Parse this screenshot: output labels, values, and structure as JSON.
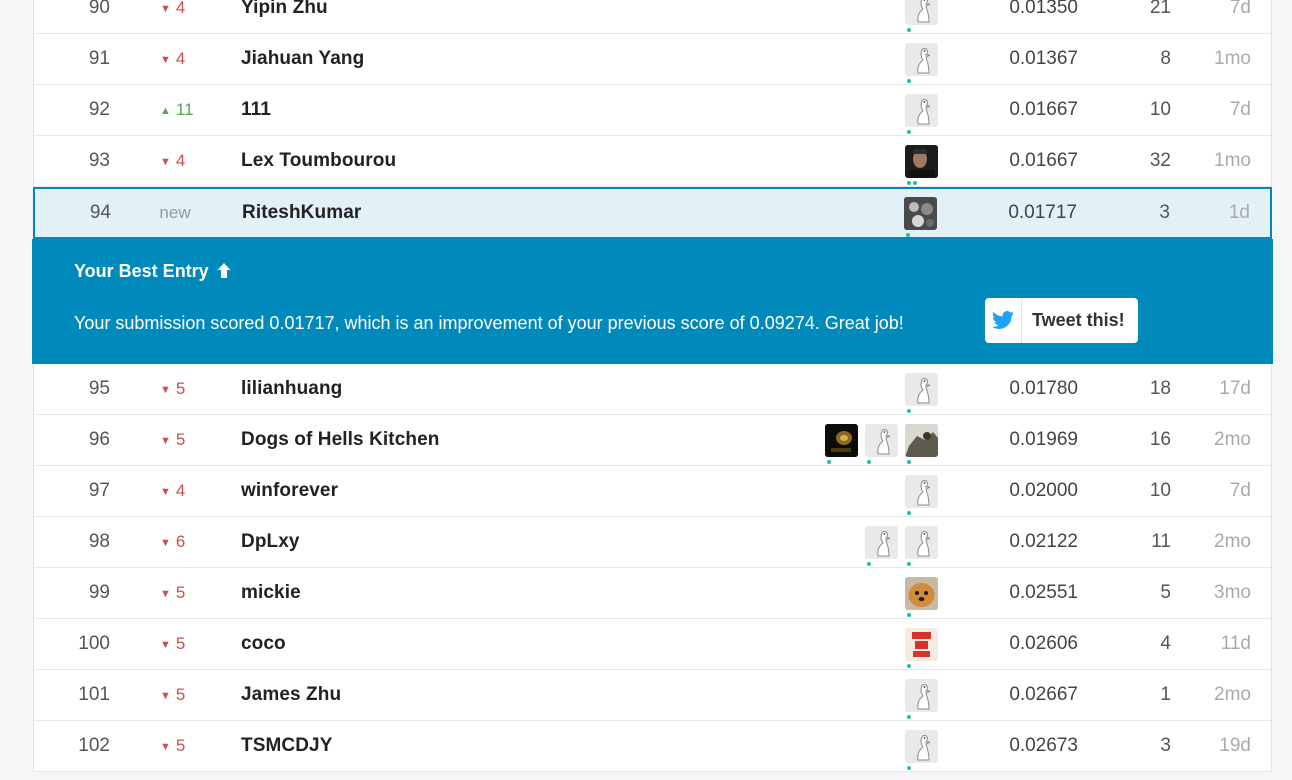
{
  "leaderboard": {
    "rows_above": [
      {
        "rank": "90",
        "change": "4",
        "dir": "down",
        "team": "Yipin Zhu",
        "avatars": [
          "goose"
        ],
        "score": "0.01350",
        "entries": "21",
        "last": "7d"
      },
      {
        "rank": "91",
        "change": "4",
        "dir": "down",
        "team": "Jiahuan Yang",
        "avatars": [
          "goose"
        ],
        "score": "0.01367",
        "entries": "8",
        "last": "1mo"
      },
      {
        "rank": "92",
        "change": "11",
        "dir": "up",
        "team": "111",
        "avatars": [
          "goose"
        ],
        "score": "0.01667",
        "entries": "10",
        "last": "7d"
      },
      {
        "rank": "93",
        "change": "4",
        "dir": "down",
        "team": "Lex Toumbourou",
        "avatars": [
          "dark"
        ],
        "score": "0.01667",
        "entries": "32",
        "last": "1mo"
      }
    ],
    "user_row": {
      "rank": "94",
      "change": "new",
      "dir": "new",
      "team": "RiteshKumar",
      "avatars": [
        "mono"
      ],
      "score": "0.01717",
      "entries": "3",
      "last": "1d"
    },
    "rows_below": [
      {
        "rank": "95",
        "change": "5",
        "dir": "down",
        "team": "lilianhuang",
        "avatars": [
          "goose"
        ],
        "score": "0.01780",
        "entries": "18",
        "last": "17d"
      },
      {
        "rank": "96",
        "change": "5",
        "dir": "down",
        "team": "Dogs of Hells Kitchen",
        "avatars": [
          "gold",
          "goose",
          "mixed"
        ],
        "score": "0.01969",
        "entries": "16",
        "last": "2mo"
      },
      {
        "rank": "97",
        "change": "4",
        "dir": "down",
        "team": "winforever",
        "avatars": [
          "goose"
        ],
        "score": "0.02000",
        "entries": "10",
        "last": "7d"
      },
      {
        "rank": "98",
        "change": "6",
        "dir": "down",
        "team": "DpLxy",
        "avatars": [
          "goose",
          "goose"
        ],
        "score": "0.02122",
        "entries": "11",
        "last": "2mo"
      },
      {
        "rank": "99",
        "change": "5",
        "dir": "down",
        "team": "mickie",
        "avatars": [
          "dog"
        ],
        "score": "0.02551",
        "entries": "5",
        "last": "3mo"
      },
      {
        "rank": "100",
        "change": "5",
        "dir": "down",
        "team": "coco",
        "avatars": [
          "red"
        ],
        "score": "0.02606",
        "entries": "4",
        "last": "11d"
      },
      {
        "rank": "101",
        "change": "5",
        "dir": "down",
        "team": "James Zhu",
        "avatars": [
          "goose"
        ],
        "score": "0.02667",
        "entries": "1",
        "last": "2mo"
      },
      {
        "rank": "102",
        "change": "5",
        "dir": "down",
        "team": "TSMCDJY",
        "avatars": [
          "goose"
        ],
        "score": "0.02673",
        "entries": "3",
        "last": "19d"
      }
    ]
  },
  "banner": {
    "title": "Your Best Entry",
    "title_icon": "arrow-up-icon",
    "message": "Your submission scored 0.01717, which is an improvement of your previous score of 0.09274. Great job!",
    "tweet_label": "Tweet this!",
    "tweet_icon": "twitter-bird-icon"
  },
  "colors": {
    "banner_bg": "#008abc",
    "highlight_bg": "#e2f0f8",
    "highlight_border": "#0b83b8",
    "down": "#c6534f",
    "up": "#4aaa4a",
    "twitter": "#1da1f2"
  }
}
